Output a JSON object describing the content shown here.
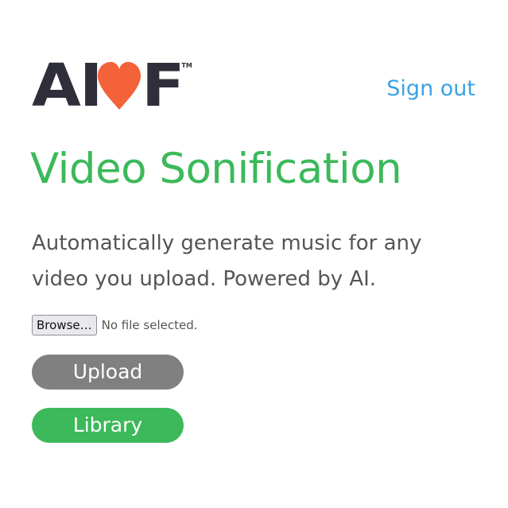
{
  "header": {
    "logo": {
      "text_left": "AI",
      "text_right": "F",
      "trademark": "TM",
      "heart_color": "#f4623a",
      "text_color": "#2f2f3b"
    },
    "signout_label": "Sign out"
  },
  "main": {
    "title": "Video Sonification",
    "description": "Automatically generate music for any video you upload. Powered by AI.",
    "file_input": {
      "button_label": "Browse…",
      "status_text": "No file selected."
    },
    "upload_label": "Upload",
    "library_label": "Library"
  },
  "colors": {
    "accent_green": "#3cb95a",
    "link_blue": "#3aa3e3",
    "disabled_gray": "#808080",
    "body_text": "#555555"
  }
}
